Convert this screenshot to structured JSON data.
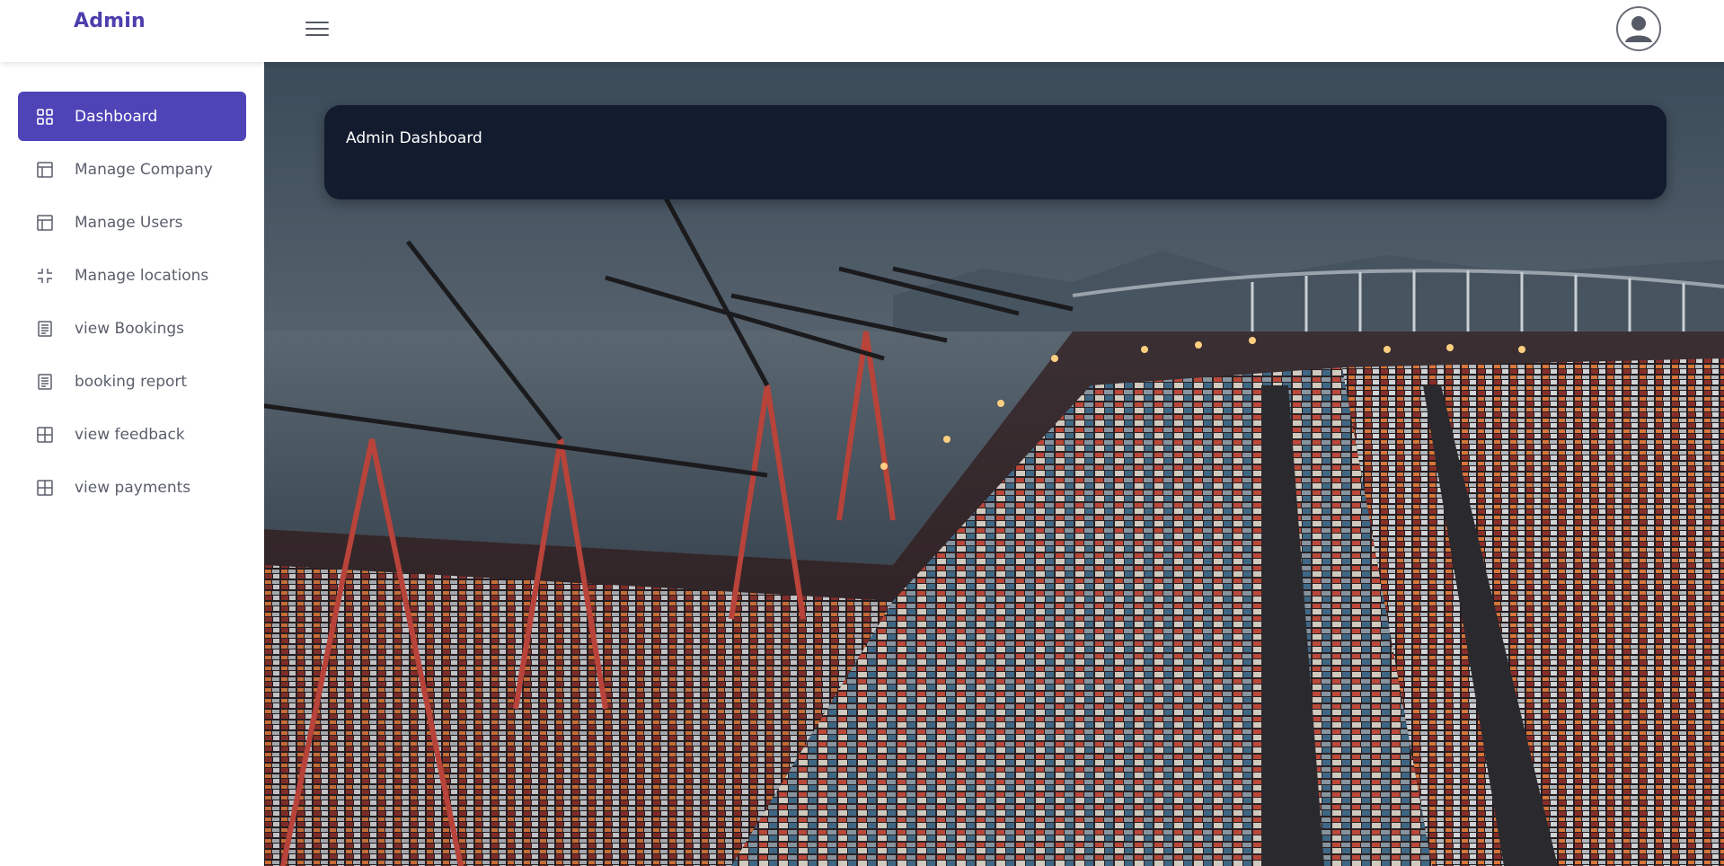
{
  "brand": {
    "title": "Admin"
  },
  "sidebar": {
    "items": [
      {
        "label": "Dashboard",
        "icon": "grid-icon",
        "active": true
      },
      {
        "label": "Manage Company",
        "icon": "layout-icon",
        "active": false
      },
      {
        "label": "Manage Users",
        "icon": "layout-icon",
        "active": false
      },
      {
        "label": "Manage locations",
        "icon": "collapse-icon",
        "active": false
      },
      {
        "label": "view Bookings",
        "icon": "document-icon",
        "active": false
      },
      {
        "label": "booking report",
        "icon": "document-icon",
        "active": false
      },
      {
        "label": "view feedback",
        "icon": "table-icon",
        "active": false
      },
      {
        "label": "view payments",
        "icon": "table-icon",
        "active": false
      }
    ]
  },
  "main": {
    "header_title": "Admin Dashboard",
    "background": "container-port-night-photo"
  },
  "colors": {
    "accent": "#4f43b8",
    "brand_text": "#4b3fae",
    "header_card": "#131c2e"
  }
}
